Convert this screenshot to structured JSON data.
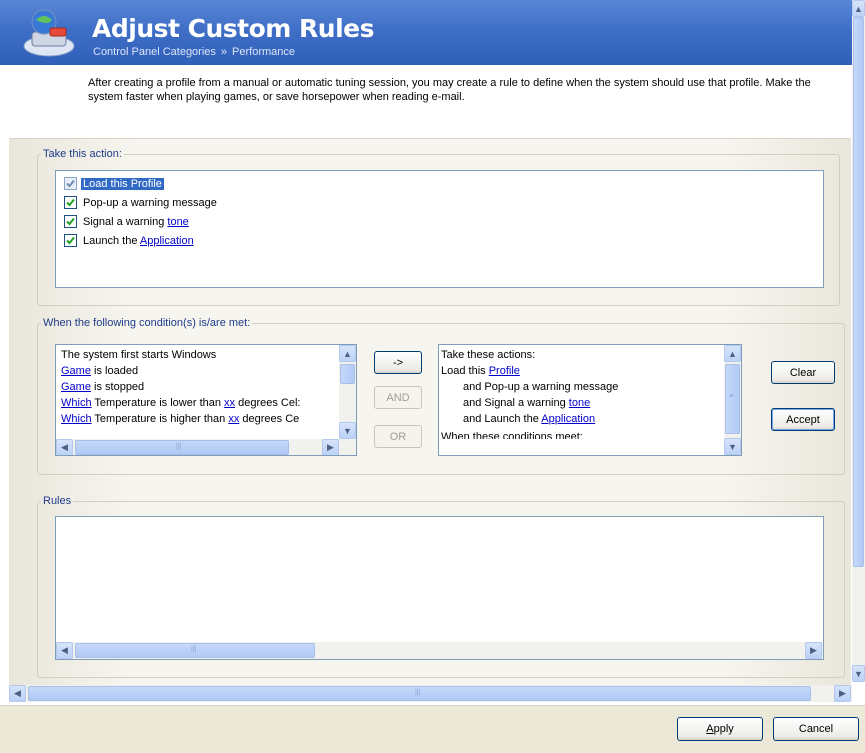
{
  "header": {
    "title": "Adjust Custom Rules",
    "breadcrumb": [
      "Control Panel Categories",
      "Performance"
    ],
    "breadcrumb_sep": "»"
  },
  "intro_text": "After creating a profile from a manual or automatic tuning session, you may create a rule to define when the system should use that profile. Make the system faster when playing games, or save horsepower when reading e-mail.",
  "action_group": {
    "legend": "Take this action:",
    "items": [
      {
        "text": "Load this ",
        "link": "Profile",
        "checked": true,
        "selected": true
      },
      {
        "text": "Pop-up a warning message",
        "link": "",
        "checked": true,
        "selected": false
      },
      {
        "text": "Signal a warning ",
        "link": "tone",
        "checked": true,
        "selected": false
      },
      {
        "text": "Launch the ",
        "link": "Application",
        "checked": true,
        "selected": false
      }
    ]
  },
  "condition_group": {
    "legend": "When the following condition(s) is/are met:",
    "conditions": [
      {
        "link": "",
        "text": "The system first starts Windows",
        "link2": "",
        "tail": ""
      },
      {
        "link": "Game",
        "text": " is loaded",
        "link2": "",
        "tail": ""
      },
      {
        "link": "Game",
        "text": " is stopped",
        "link2": "",
        "tail": ""
      },
      {
        "link": "Which",
        "text": " Temperature is lower than ",
        "link2": "xx",
        "tail": " degrees Cel:"
      },
      {
        "link": "Which",
        "text": " Temperature is higher than ",
        "link2": "xx",
        "tail": " degrees Ce"
      }
    ],
    "buttons": {
      "add": "->",
      "and": "AND",
      "or": "OR"
    },
    "summary": {
      "heading": "Take these actions:",
      "lines": [
        {
          "indent": false,
          "text": "Load this ",
          "link": "Profile"
        },
        {
          "indent": true,
          "text": "and Pop-up a warning message",
          "link": ""
        },
        {
          "indent": true,
          "text": "and Signal a warning ",
          "link": "tone"
        },
        {
          "indent": true,
          "text": "and Launch the ",
          "link": "Application"
        },
        {
          "indent": false,
          "text": "When these conditions meet:",
          "link": ""
        }
      ]
    },
    "clear_label": "Clear",
    "accept_label": "Accept"
  },
  "rules_group": {
    "legend": "Rules"
  },
  "footer": {
    "apply_label": "Apply",
    "apply_underline": "A",
    "apply_rest": "pply",
    "cancel_label": "Cancel"
  }
}
